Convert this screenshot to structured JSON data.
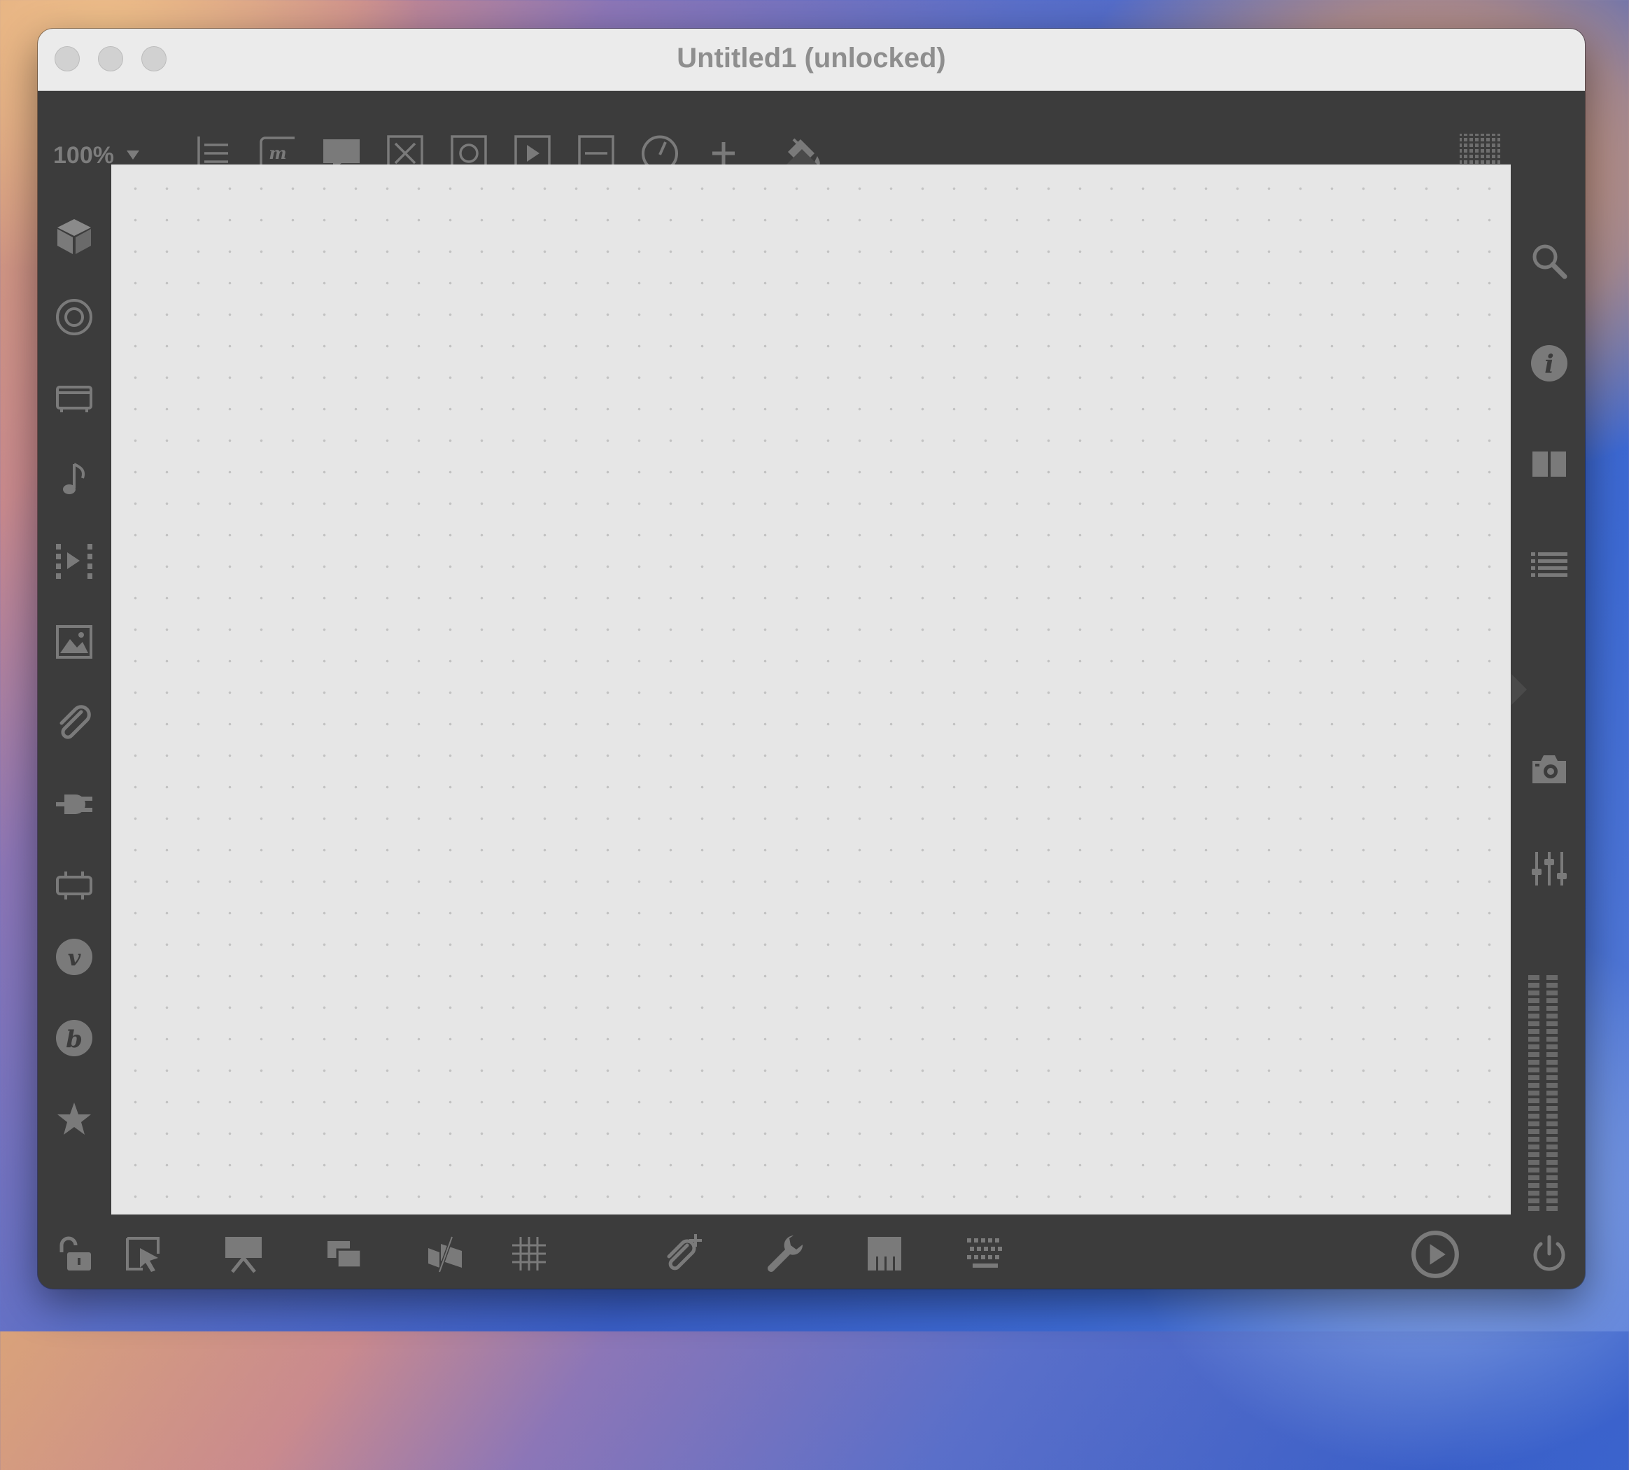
{
  "window": {
    "title": "Untitled1 (unlocked)"
  },
  "toolbar": {
    "zoom_label": "100%",
    "tools": [
      {
        "name": "comment-object-icon"
      },
      {
        "name": "message-object-icon"
      },
      {
        "name": "speech-bubble-icon"
      },
      {
        "name": "toggle-object-icon"
      },
      {
        "name": "button-object-icon"
      },
      {
        "name": "play-button-object-icon"
      },
      {
        "name": "slider-object-icon"
      },
      {
        "name": "dial-object-icon"
      },
      {
        "name": "add-object-icon"
      },
      {
        "name": "paint-bucket-icon"
      }
    ],
    "grid_toggle": "grid-dots-icon"
  },
  "left_sidebar": {
    "items": [
      "cube-icon",
      "circle-target-icon",
      "tv-icon",
      "music-note-icon",
      "video-step-icon",
      "image-icon",
      "paperclip-icon",
      "plug-icon",
      "hardware-icon",
      "vimeo-icon",
      "bold-b-icon",
      "star-icon"
    ]
  },
  "right_sidebar": {
    "items": [
      "search-icon",
      "info-icon",
      "columns-icon",
      "list-icon",
      "camera-icon",
      "mixer-icon"
    ],
    "meter": "level-meter"
  },
  "bottom_bar": {
    "items": [
      "lock-open-icon",
      "select-pointer-icon",
      "presentation-icon",
      "layers-icon",
      "flags-icon",
      "grid-icon",
      "add-attachment-icon",
      "wrench-icon",
      "piano-icon",
      "keyboard-icon",
      "play-circle-icon",
      "power-icon"
    ]
  },
  "colors": {
    "chrome": "#3c3c3c",
    "icon": "#7a7a7a",
    "canvas": "#e6e6e6",
    "titlebar": "#ebebeb"
  }
}
